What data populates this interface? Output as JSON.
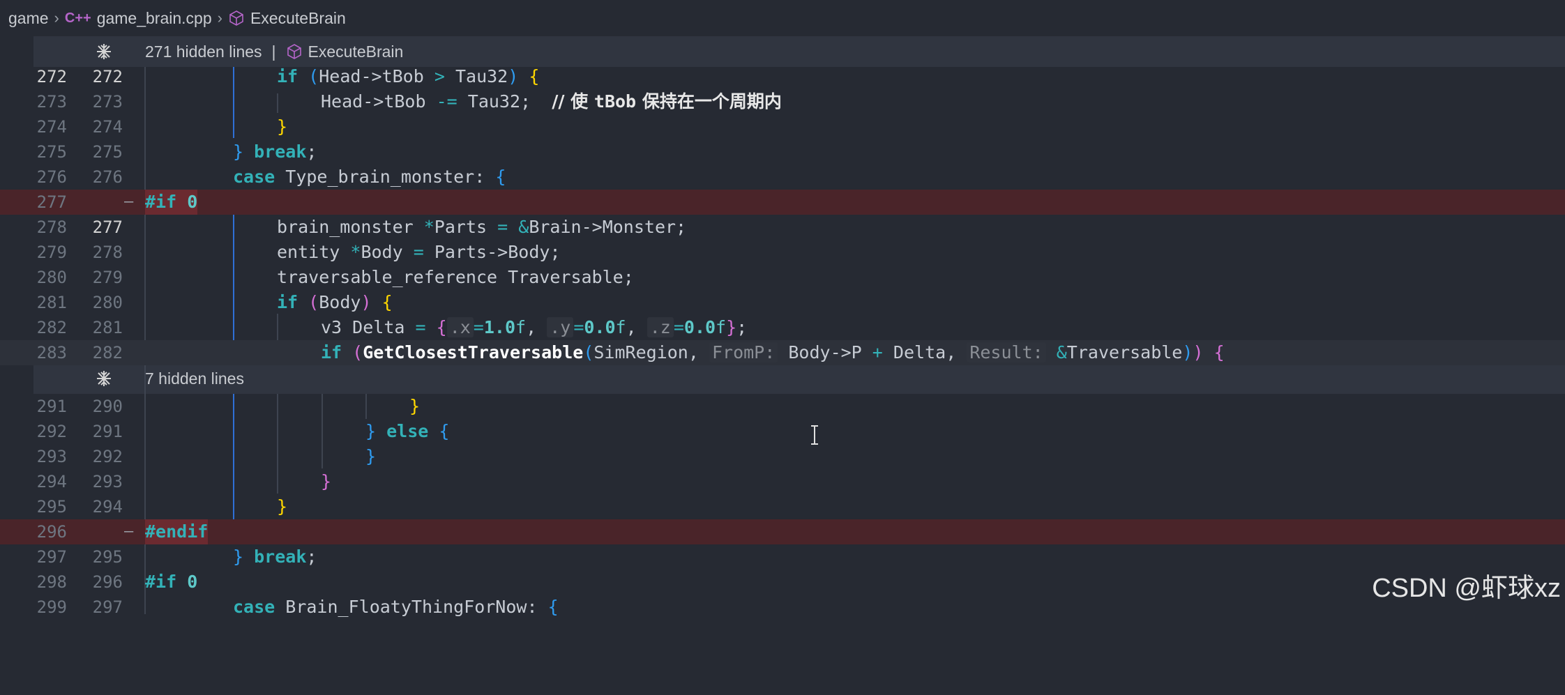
{
  "breadcrumb": {
    "folder": "game",
    "file": "game_brain.cpp",
    "symbol": "ExecuteBrain",
    "file_icon": "C++"
  },
  "hidden_top": {
    "text": "271 hidden lines",
    "separator": "|",
    "symbol": "ExecuteBrain"
  },
  "hidden_mid": {
    "text": "7 hidden lines"
  },
  "line_numbers": {
    "l272": [
      "272",
      "272"
    ],
    "l273": [
      "273",
      "273"
    ],
    "l274": [
      "274",
      "274"
    ],
    "l275": [
      "275",
      "275"
    ],
    "l276": [
      "276",
      "276"
    ],
    "l277": [
      "277",
      ""
    ],
    "l278": [
      "278",
      "277"
    ],
    "l279": [
      "279",
      "278"
    ],
    "l280": [
      "280",
      "279"
    ],
    "l281": [
      "281",
      "280"
    ],
    "l282": [
      "282",
      "281"
    ],
    "l283": [
      "283",
      "282"
    ],
    "l291": [
      "291",
      "290"
    ],
    "l292": [
      "292",
      "291"
    ],
    "l293": [
      "293",
      "292"
    ],
    "l294": [
      "294",
      "293"
    ],
    "l295": [
      "295",
      "294"
    ],
    "l296": [
      "296",
      ""
    ],
    "l297": [
      "297",
      "295"
    ],
    "l298": [
      "298",
      "296"
    ],
    "l299": [
      "299",
      "297"
    ]
  },
  "fold_marker": "—",
  "code": {
    "kw_if": "if",
    "kw_break": "break",
    "kw_case": "case",
    "kw_else": "else",
    "pp_if": "#if",
    "pp_zero": "0",
    "pp_endif": "#endif",
    "head": "Head",
    "arrow": "->",
    "tbob": "tBob",
    "gt": ">",
    "tau32": "Tau32",
    "minus_eq": "-=",
    "semi": ";",
    "comment_prefix": "// 使 ",
    "comment_tbob": "tBob",
    "comment_rest": " 保持在一个周期内",
    "type_brain_monster_label": "Type_brain_monster:",
    "brain_monster": "brain_monster",
    "star": "*",
    "parts": "Parts",
    "eq": "=",
    "amp": "&",
    "brain": "Brain",
    "monster": "Monster",
    "entity": "entity",
    "body": "Body",
    "traversable_reference": "traversable_reference",
    "traversable": "Traversable",
    "v3": "v3",
    "delta": "Delta",
    "dot_x": ".x",
    "dot_y": ".y",
    "dot_z": ".z",
    "num_1": "1.0",
    "num_0": "0.0",
    "suf_f": "f",
    "comma": ",",
    "get_closest": "GetClosestTraversable",
    "sim_region": "SimRegion",
    "hint_fromp": "FromP:",
    "p": "P",
    "plus": "+",
    "hint_result": "Result:",
    "brain_floaty_label": "Brain_FloatyThingForNow:",
    "lbrace": "{",
    "rbrace": "}",
    "lparen": "(",
    "rparen": ")",
    "space": " "
  },
  "watermark": "CSDN @虾球xz"
}
